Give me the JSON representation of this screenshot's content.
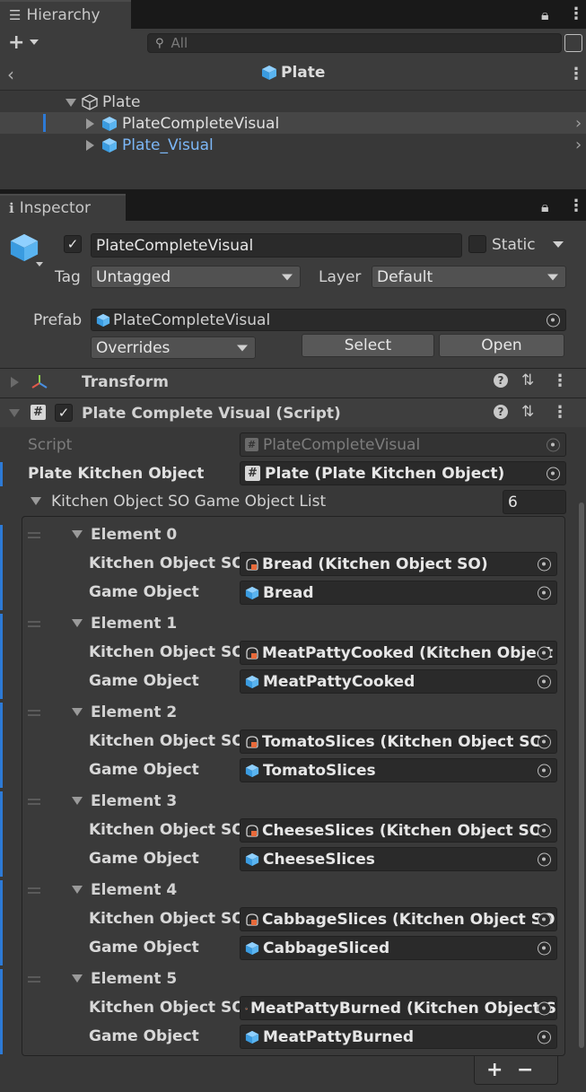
{
  "hierarchy": {
    "tab_label": "Hierarchy",
    "search_placeholder": "All",
    "breadcrumb_title": "Plate",
    "tree": [
      {
        "label": "Plate",
        "expanded": true
      },
      {
        "label": "PlateCompleteVisual",
        "selected": true
      },
      {
        "label": "Plate_Visual",
        "prefab_blue": true
      }
    ]
  },
  "inspector": {
    "tab_label": "Inspector",
    "object_name": "PlateCompleteVisual",
    "static_label": "Static",
    "tag_label": "Tag",
    "tag_value": "Untagged",
    "layer_label": "Layer",
    "layer_value": "Default",
    "prefab_label": "Prefab",
    "prefab_value": "PlateCompleteVisual",
    "overrides_label": "Overrides",
    "select_label": "Select",
    "open_label": "Open"
  },
  "components": {
    "transform_title": "Transform",
    "script_component_title": "Plate Complete Visual (Script)",
    "script_label": "Script",
    "script_value": "PlateCompleteVisual",
    "plate_kitchen_label": "Plate Kitchen Object",
    "plate_kitchen_value": "Plate (Plate Kitchen Object)",
    "list_label": "Kitchen Object SO Game Object List",
    "list_size": "6",
    "kso_label": "Kitchen Object SO",
    "go_label": "Game Object",
    "elements": [
      {
        "title": "Element 0",
        "kso": "Bread (Kitchen Object SO)",
        "go": "Bread"
      },
      {
        "title": "Element 1",
        "kso": "MeatPattyCooked (Kitchen Object",
        "go": "MeatPattyCooked"
      },
      {
        "title": "Element 2",
        "kso": "TomatoSlices (Kitchen Object SO)",
        "go": "TomatoSlices"
      },
      {
        "title": "Element 3",
        "kso": "CheeseSlices (Kitchen Object SO)",
        "go": "CheeseSlices"
      },
      {
        "title": "Element 4",
        "kso": "CabbageSlices (Kitchen Object SO",
        "go": "CabbageSliced"
      },
      {
        "title": "Element 5",
        "kso": "MeatPattyBurned (Kitchen Object S",
        "go": "MeatPattyBurned"
      }
    ],
    "add_label": "+",
    "remove_label": "−"
  },
  "colors": {
    "accent_blue": "#2d7ad6",
    "prefab_text_blue": "#7cb7f7",
    "cube_blue": "#5ab4f0"
  }
}
